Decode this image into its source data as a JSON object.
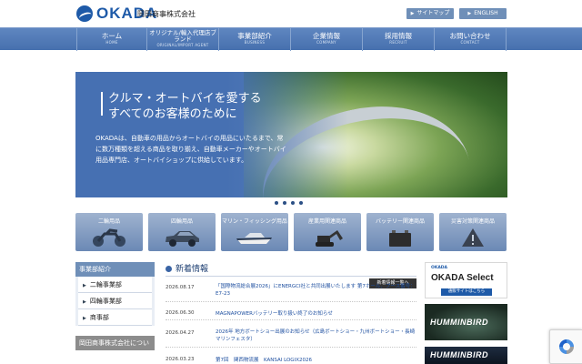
{
  "header": {
    "logo_text": "OKADA",
    "company_name": "岡田商事株式会社",
    "sitemap_label": "サイトマップ",
    "english_label": "ENGLISH"
  },
  "nav": [
    {
      "jp": "ホーム",
      "en": "HOME"
    },
    {
      "jp": "オリジナル/輸入代理店ブランド",
      "en": "ORIGINAL/IMPORT AGENT"
    },
    {
      "jp": "事業部紹介",
      "en": "BUSINESS"
    },
    {
      "jp": "企業情報",
      "en": "COMPANY"
    },
    {
      "jp": "採用情報",
      "en": "RECRUIT"
    },
    {
      "jp": "お問い合わせ",
      "en": "CONTACT"
    }
  ],
  "hero": {
    "title_line1": "クルマ・オートバイを愛する",
    "title_line2": "すべてのお客様のために",
    "text": "OKADAは、自動車の用品からオートバイの用品にいたるまで、常に数万種類を超える商品を取り揃え、自動車メーカーやオートバイ用品専門店、オートバイショップに供給しています。",
    "slide_count": 4
  },
  "categories": [
    {
      "label": "二輪用品",
      "icon": "motorcycle-icon"
    },
    {
      "label": "四輪用品",
      "icon": "car-icon"
    },
    {
      "label": "マリン・フィッシング用品",
      "icon": "boat-icon"
    },
    {
      "label": "産業用関連商品",
      "icon": "excavator-icon"
    },
    {
      "label": "バッテリー関連商品",
      "icon": "battery-icon"
    },
    {
      "label": "災害対策関連商品",
      "icon": "warning-sign-icon"
    }
  ],
  "sidebar": {
    "heading": "事業部紹介",
    "items": [
      "二輪事業部",
      "四輪事業部",
      "商事部"
    ],
    "heading2": "岡田商事株式会社について"
  },
  "news": {
    "title": "新着情報",
    "list_button": "新着情報一覧へ",
    "items": [
      {
        "date": "2026.08.17",
        "text": "「国際物流総合展2026」にENERGCI社と共同出展いたします 第7ホール、ブース番号：E7-23"
      },
      {
        "date": "2026.06.30",
        "text": "MAGNAPOWERバッテリー取り扱い終了のお知らせ"
      },
      {
        "date": "2026.04.27",
        "text": "2026年 地方ボートショー出展のお知らせ（広島ボートショー・九州ボートショー・長崎マリンフェスタ）"
      },
      {
        "date": "2026.03.23",
        "text": "第7回　関西物流展　KANSAI LOGIX2026"
      }
    ]
  },
  "banners": {
    "okada_small": "OKADA",
    "select_title": "OKADA Select",
    "select_button": "通販サイトはこちら",
    "humminbird1": "HUMMINBIRD",
    "humminbird2": "HUMMINBIRD"
  },
  "colors": {
    "brand_blue": "#1e5aa8",
    "nav_blue": "#4f78b5",
    "category_blue": "#7d97bf"
  }
}
